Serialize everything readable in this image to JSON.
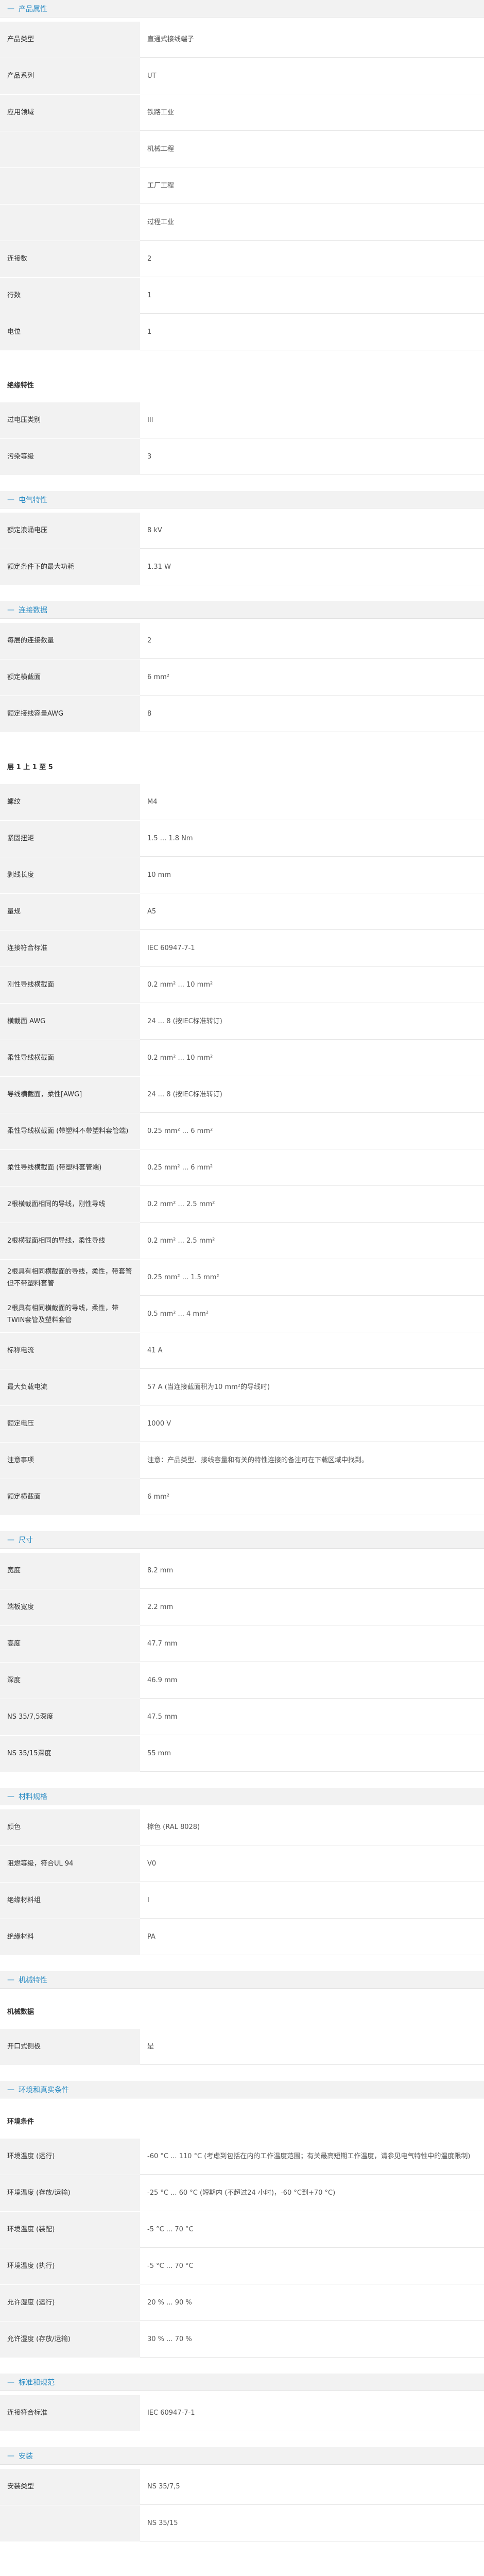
{
  "sections": [
    {
      "title": "产品属性",
      "rows": [
        {
          "label": "产品类型",
          "value": "直通式接线端子"
        },
        {
          "label": "产品系列",
          "value": "UT"
        },
        {
          "label": "应用领域",
          "value": "铁路工业"
        },
        {
          "label": "",
          "value": "机械工程"
        },
        {
          "label": "",
          "value": "工厂工程"
        },
        {
          "label": "",
          "value": "过程工业"
        },
        {
          "label": "连接数",
          "value": "2"
        },
        {
          "label": "行数",
          "value": "1"
        },
        {
          "label": "电位",
          "value": "1"
        }
      ],
      "sub": {
        "title": "绝缘特性",
        "rows": [
          {
            "label": "过电压类别",
            "value": "III"
          },
          {
            "label": "污染等级",
            "value": "3"
          }
        ]
      }
    },
    {
      "title": "电气特性",
      "rows": [
        {
          "label": "额定浪涌电压",
          "value": "8 kV"
        },
        {
          "label": "额定条件下的最大功耗",
          "value": "1.31 W"
        }
      ]
    },
    {
      "title": "连接数据",
      "rows": [
        {
          "label": "每层的连接数量",
          "value": "2"
        },
        {
          "label": "额定横截面",
          "value": "6 mm²"
        },
        {
          "label": "额定接线容量AWG",
          "value": "8"
        }
      ],
      "sub": {
        "title": "层 1 上 1 至 5",
        "rows": [
          {
            "label": "螺纹",
            "value": "M4"
          },
          {
            "label": "紧固扭矩",
            "value": "1.5 ... 1.8 Nm"
          },
          {
            "label": "剥线长度",
            "value": "10 mm"
          },
          {
            "label": "量规",
            "value": "A5"
          },
          {
            "label": "连接符合标准",
            "value": "IEC 60947-7-1"
          },
          {
            "label": "刚性导线横截面",
            "value": "0.2 mm² ... 10 mm²"
          },
          {
            "label": "横截面 AWG",
            "value": "24 ... 8 (按IEC标准转订)"
          },
          {
            "label": "柔性导线横截面",
            "value": "0.2 mm² ... 10 mm²"
          },
          {
            "label": "导线横截面，柔性[AWG]",
            "value": "24 ... 8 (按IEC标准转订)"
          },
          {
            "label": "柔性导线横截面 (带塑料不带塑料套管端)",
            "value": "0.25 mm² ... 6 mm²"
          },
          {
            "label": "柔性导线横截面 (带塑料套管端)",
            "value": "0.25 mm² ... 6 mm²"
          },
          {
            "label": "2根横截面相同的导线，刚性导线",
            "value": "0.2 mm² ... 2.5 mm²"
          },
          {
            "label": "2根横截面相同的导线，柔性导线",
            "value": "0.2 mm² ... 2.5 mm²"
          },
          {
            "label": "2根具有相同横截面的导线，柔性，带套管但不带塑料套管",
            "value": "0.25 mm² ... 1.5 mm²"
          },
          {
            "label": "2根具有相同横截面的导线，柔性，带TWIN套管及塑料套管",
            "value": "0.5 mm² ... 4 mm²"
          },
          {
            "label": "标称电流",
            "value": "41 A"
          },
          {
            "label": "最大负载电流",
            "value": "57 A (当连接截面积为10 mm²的导线时)"
          },
          {
            "label": "额定电压",
            "value": "1000 V"
          },
          {
            "label": "注意事项",
            "value": "注意：产品类型、接线容量和有关的特性连接的备注可在下载区域中找到。"
          },
          {
            "label": "额定横截面",
            "value": "6 mm²"
          }
        ]
      }
    },
    {
      "title": "尺寸",
      "rows": [
        {
          "label": "宽度",
          "value": "8.2 mm"
        },
        {
          "label": "端板宽度",
          "value": "2.2 mm"
        },
        {
          "label": "高度",
          "value": "47.7 mm"
        },
        {
          "label": "深度",
          "value": "46.9 mm"
        },
        {
          "label": "NS 35/7,5深度",
          "value": "47.5 mm"
        },
        {
          "label": "NS 35/15深度",
          "value": "55 mm"
        }
      ]
    },
    {
      "title": "材料规格",
      "rows": [
        {
          "label": "颜色",
          "value": "棕色 (RAL 8028)"
        },
        {
          "label": "阻燃等级，符合UL 94",
          "value": "V0"
        },
        {
          "label": "绝缘材料组",
          "value": "I"
        },
        {
          "label": "绝缘材料",
          "value": "PA"
        }
      ]
    },
    {
      "title": "机械特性",
      "rows": [],
      "sub": {
        "title": "机械数据",
        "rows": [
          {
            "label": "开口式侧板",
            "value": "是"
          }
        ]
      }
    },
    {
      "title": "环境和真实条件",
      "rows": [],
      "sub": {
        "title": "环境条件",
        "rows": [
          {
            "label": "环境温度 (运行)",
            "value": "-60 °C ... 110 °C (考虑到包括在内的工作温度范围；有关最高短期工作温度，请参见电气特性中的温度限制)"
          },
          {
            "label": "环境温度 (存放/运输)",
            "value": "-25 °C ... 60 °C (短期内 (不超过24 小时)，-60 °C到+70 °C)"
          },
          {
            "label": "环境温度 (装配)",
            "value": "-5 °C ... 70 °C"
          },
          {
            "label": "环境温度 (执行)",
            "value": "-5 °C ... 70 °C"
          },
          {
            "label": "允许湿度 (运行)",
            "value": "20 % ... 90 %"
          },
          {
            "label": "允许湿度 (存放/运输)",
            "value": "30 % ... 70 %"
          }
        ]
      }
    },
    {
      "title": "标准和规范",
      "rows": [
        {
          "label": "连接符合标准",
          "value": "IEC 60947-7-1"
        }
      ]
    },
    {
      "title": "安装",
      "rows": [
        {
          "label": "安装类型",
          "value": "NS 35/7,5"
        },
        {
          "label": "",
          "value": "NS 35/15"
        }
      ]
    }
  ]
}
